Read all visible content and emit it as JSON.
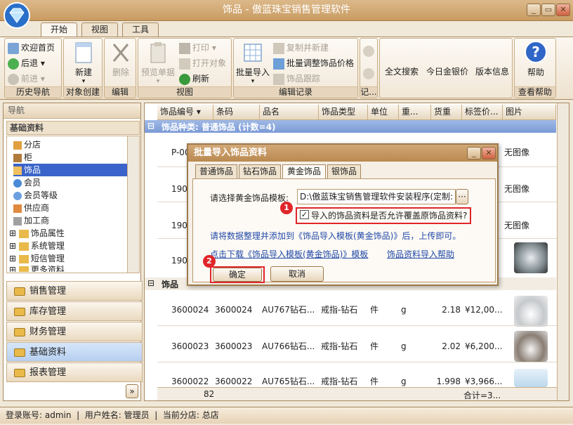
{
  "app": {
    "title": "饰品 - 傲蓝珠宝销售管理软件"
  },
  "window_buttons": {
    "minimize": "_",
    "restore": "▭",
    "close": "✕"
  },
  "tabs": [
    "开始",
    "视图",
    "工具"
  ],
  "ribbon": {
    "history": {
      "home": "欢迎首页",
      "back": "后退",
      "forward": "前进",
      "label": "历史导航"
    },
    "create": {
      "new": "新建",
      "label": "对象创建"
    },
    "edit": {
      "delete": "删除",
      "label": "编辑"
    },
    "view": {
      "preview": "预览单据",
      "print": "打印",
      "open": "打开对象",
      "refresh": "刷新",
      "label": "视图"
    },
    "records": {
      "batch_import": "批量导入",
      "copy_new": "复制并新建",
      "batch_adjust": "批量调整饰品价格",
      "trace": "饰品跟踪",
      "label": "编辑记录"
    },
    "records2": {
      "label": "记..."
    },
    "misc": {
      "fulltext": "全文搜索",
      "gold_price": "今日金银价",
      "version": "版本信息"
    },
    "help": {
      "help": "帮助",
      "label": "查看帮助"
    }
  },
  "nav": {
    "header": "导航",
    "section": "基础资料",
    "tree": [
      "分店",
      "柜",
      "饰品",
      "会员",
      "会员等级",
      "供应商",
      "加工商",
      "饰品属性",
      "系统管理",
      "短信管理",
      "更多资料"
    ],
    "modules": [
      "销售管理",
      "库存管理",
      "财务管理",
      "基础资料",
      "报表管理"
    ]
  },
  "grid": {
    "columns": [
      "饰品编号",
      "条码",
      "品名",
      "饰品类型",
      "单位",
      "重...",
      "货重",
      "标签价...",
      "图片"
    ],
    "group1": "饰品种类: 普通饰品 (计数=4)",
    "group1_rows": [
      {
        "code": "P-00",
        "img": "无图像"
      },
      {
        "code": "190",
        "img": "无图像"
      },
      {
        "code": "190",
        "img": "无图像"
      },
      {
        "code": "190",
        "img": ""
      }
    ],
    "group2": "饰品",
    "rows": [
      {
        "code": "3600024",
        "barcode": "3600024",
        "name": "AU767钻石...",
        "type": "戒指-钻石",
        "unit": "件",
        "weight": "g",
        "net": "2.18",
        "price": "¥12,00..."
      },
      {
        "code": "3600023",
        "barcode": "3600023",
        "name": "AU766钻石...",
        "type": "戒指-钻石",
        "unit": "件",
        "weight": "g",
        "net": "2.02",
        "price": "¥6,200...."
      },
      {
        "code": "3600022",
        "barcode": "3600022",
        "name": "AU765钻石...",
        "type": "戒指-钻石",
        "unit": "件",
        "weight": "g",
        "net": "1.998",
        "price": "¥3,966...."
      }
    ],
    "footer_count": "82",
    "footer_sum": "合计=3..."
  },
  "dialog": {
    "title": "批量导入饰品资料",
    "tabs": [
      "普通饰品",
      "钻石饰品",
      "黄金饰品",
      "银饰品"
    ],
    "template_label": "请选择黄金饰品模板:",
    "template_path": "D:\\傲蓝珠宝销售管理软件安装程序(定制:",
    "browse": "···",
    "overwrite_label": "导入的饰品资料是否允许覆盖原饰品资料?",
    "hint": "请将数据整理并添加到《饰品导入模板(黄金饰品)》后，上传即可。",
    "download_link": "点击下载《饰品导入模板(黄金饰品)》模板",
    "help_link": "饰品资料导入帮助",
    "ok": "确定",
    "cancel": "取消",
    "badge1": "1",
    "badge2": "2"
  },
  "status": {
    "text": "登录账号: admin  |  用户姓名: 管理员  |  当前分店: 总店"
  }
}
